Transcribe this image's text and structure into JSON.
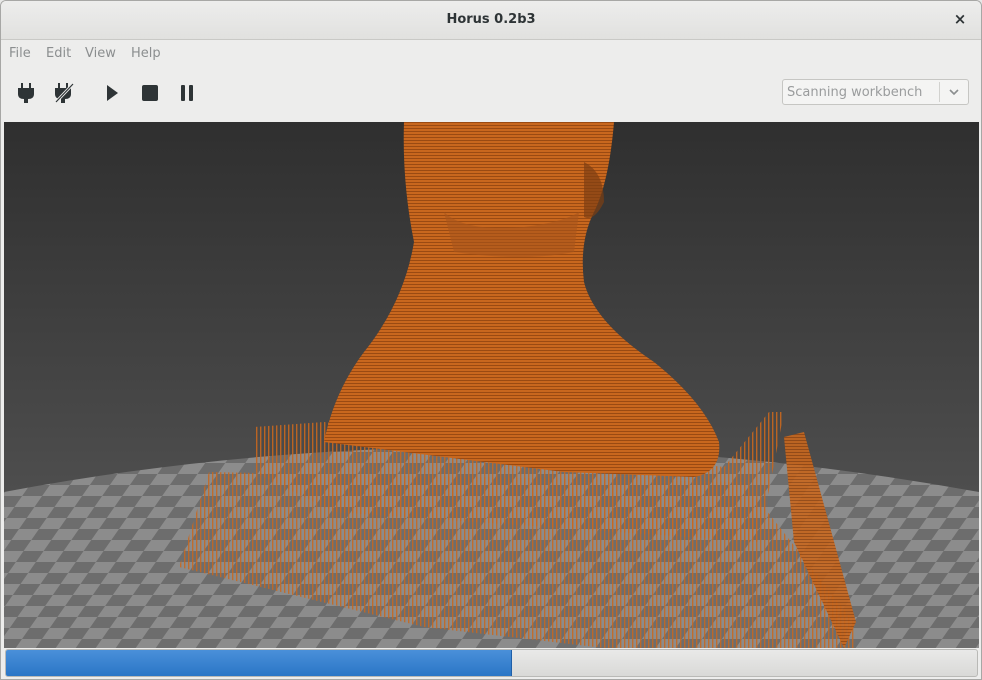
{
  "window": {
    "title": "Horus 0.2b3",
    "close_glyph": "×"
  },
  "menu": {
    "items": [
      "File",
      "Edit",
      "View",
      "Help"
    ]
  },
  "toolbar": {
    "buttons": [
      {
        "name": "connect-icon"
      },
      {
        "name": "disconnect-icon"
      },
      {
        "name": "play-icon"
      },
      {
        "name": "stop-icon"
      },
      {
        "name": "pause-icon"
      }
    ],
    "workbench_selector": {
      "value": "Scanning workbench"
    }
  },
  "viewport": {
    "background_top": "#2f2f2f",
    "background_bottom": "#5b5b5b",
    "pointcloud_color": "#c8671e",
    "platform_light": "#8a8a8a",
    "platform_dark": "#6a6a6a"
  },
  "status": {
    "progress": 0.52,
    "accent": "#2f7fd0"
  }
}
